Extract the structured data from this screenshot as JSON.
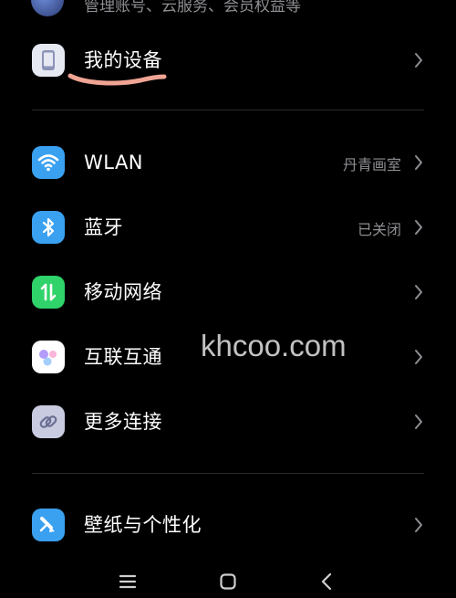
{
  "account": {
    "subtitle": "管理账号、云服务、会员权益等"
  },
  "settings": {
    "my_device": {
      "label": "我的设备",
      "icon": "phone-device-icon"
    },
    "wlan": {
      "label": "WLAN",
      "value": "丹青画室",
      "icon": "wifi-icon"
    },
    "bluetooth": {
      "label": "蓝牙",
      "value": "已关闭",
      "icon": "bluetooth-icon"
    },
    "mobile_network": {
      "label": "移动网络",
      "icon": "mobile-data-icon"
    },
    "interconnect": {
      "label": "互联互通",
      "icon": "interconnect-icon"
    },
    "more_connections": {
      "label": "更多连接",
      "icon": "link-icon"
    },
    "wallpaper": {
      "label": "壁纸与个性化",
      "icon": "wallpaper-brush-icon"
    }
  },
  "watermark": "khcoo.com",
  "colors": {
    "background": "#000000",
    "wifi": "#3aa0f0",
    "bluetooth": "#3aa0f0",
    "mobile": "#2fd36a",
    "underline": "#f0a493"
  },
  "navbar": {
    "icons": [
      "menu-icon",
      "home-icon",
      "back-icon"
    ]
  }
}
